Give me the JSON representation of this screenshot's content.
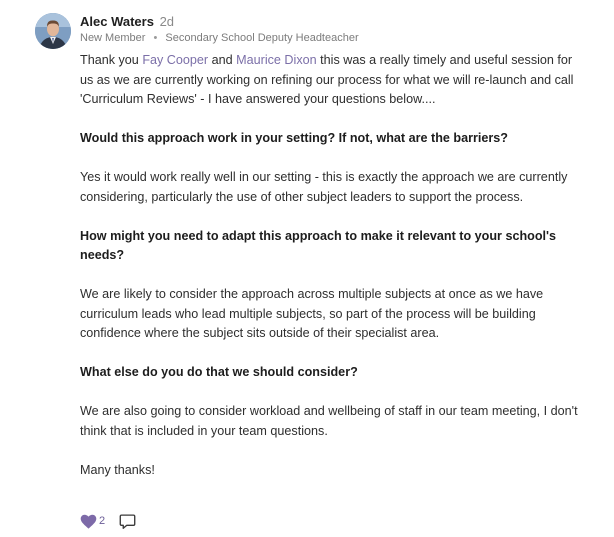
{
  "author": {
    "name": "Alec Waters",
    "time_ago": "2d",
    "member_status": "New Member",
    "role": "Secondary School Deputy Headteacher"
  },
  "post": {
    "intro": {
      "before_1": "Thank you ",
      "mention_1": "Fay Cooper",
      "between": " and ",
      "mention_2": "Maurice Dixon",
      "after": " this was a really timely and useful session for us as we are currently working on refining our process for what we will re-launch and call 'Curriculum Reviews' - I have answered your questions below...."
    },
    "q1": "Would this approach work in your setting? If not, what are the barriers?",
    "a1": "Yes it would work really well in our setting - this is exactly the approach we are currently considering, particularly the use of other subject leaders to support the process.",
    "q2": "How might you need to adapt this approach to make it relevant to your school's needs?",
    "a2": "We are likely to consider the approach across multiple subjects at once as we have curriculum leads who lead multiple subjects, so part of the process will be building confidence where the subject sits outside of their specialist area.",
    "q3": "What else do you do that we should consider?",
    "a3": "We are also going to consider workload and wellbeing of staff in our team meeting, I don't think that is included in your team questions.",
    "signoff": "Many thanks!"
  },
  "reactions": {
    "like_count": "2",
    "like_icon": "heart-icon",
    "comment_icon": "comment-icon"
  },
  "colors": {
    "mention": "#7b6fa8",
    "heart": "#7d6aa8",
    "text": "#2e2e2e",
    "muted": "#7c7c7c"
  }
}
